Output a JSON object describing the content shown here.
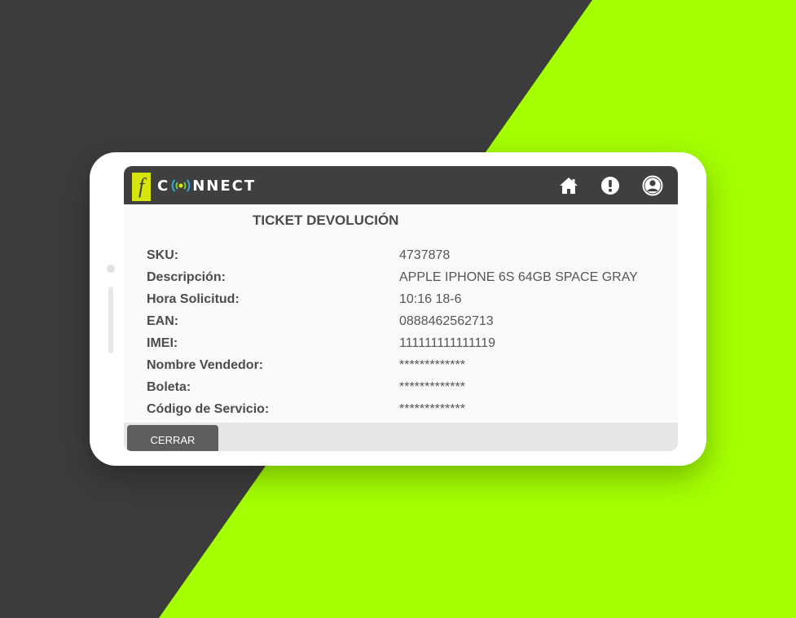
{
  "colors": {
    "dark_bg": "#3c3c3c",
    "lime_bg": "#a4ff00",
    "topbar": "#3f3f3f",
    "logo_yellow": "#d6e60a"
  },
  "app": {
    "logo_letter": "f",
    "logo_text_pre": "C",
    "logo_text_post": "NNECT",
    "logo_wave_icon": "wireless-signal-icon"
  },
  "nav": [
    {
      "icon": "home-icon"
    },
    {
      "icon": "alert-icon"
    },
    {
      "icon": "user-icon"
    }
  ],
  "ticket": {
    "title": "TICKET DEVOLUCIÓN",
    "fields": [
      {
        "label": "SKU:",
        "value": "4737878"
      },
      {
        "label": "Descripción:",
        "value": "APPLE IPHONE 6S 64GB SPACE GRAY"
      },
      {
        "label": "Hora Solicitud:",
        "value": "10:16 18-6"
      },
      {
        "label": "EAN:",
        "value": "0888462562713"
      },
      {
        "label": "IMEI:",
        "value": "111111111111119"
      },
      {
        "label": "Nombre Vendedor:",
        "value": "*************"
      },
      {
        "label": "Boleta:",
        "value": "*************"
      },
      {
        "label": "Código de Servicio:",
        "value": "*************"
      }
    ]
  },
  "footer": {
    "close_label": "CERRAR"
  }
}
